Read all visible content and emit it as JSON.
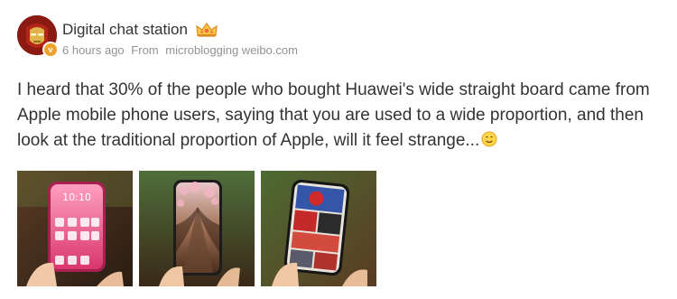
{
  "author": {
    "name": "Digital chat station",
    "avatar_icon": "iron-man-avatar",
    "verified_badge": "v",
    "crown_icon": "crown-icon"
  },
  "meta": {
    "time": "6 hours ago",
    "from_label": "From",
    "source": "microblogging weibo.com"
  },
  "post": {
    "text": "I heard that 30% of the people who bought Huawei's wide straight board came from Apple mobile phone users, saying that you are used to a wide proportion, and then look at the traditional proportion of Apple, will it feel strange...",
    "emoji": "smile-icon"
  },
  "images": [
    {
      "name": "phone-photo-pink",
      "clock": "10:10"
    },
    {
      "name": "phone-photo-street"
    },
    {
      "name": "phone-photo-comic"
    }
  ],
  "colors": {
    "text": "#333333",
    "meta": "#939393",
    "badge": "#f0a12c"
  }
}
